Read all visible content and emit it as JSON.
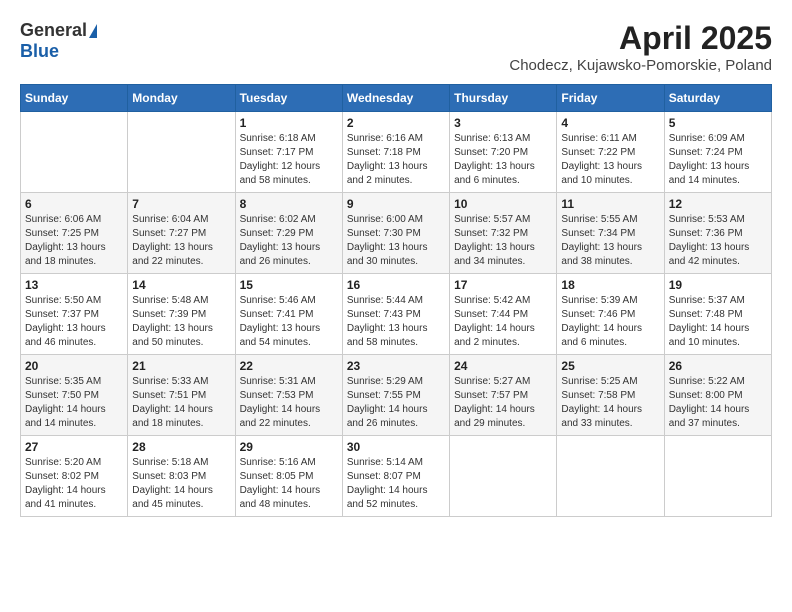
{
  "logo": {
    "general": "General",
    "blue": "Blue"
  },
  "title": {
    "month_year": "April 2025",
    "location": "Chodecz, Kujawsko-Pomorskie, Poland"
  },
  "weekdays": [
    "Sunday",
    "Monday",
    "Tuesday",
    "Wednesday",
    "Thursday",
    "Friday",
    "Saturday"
  ],
  "weeks": [
    [
      {
        "day": "",
        "detail": ""
      },
      {
        "day": "",
        "detail": ""
      },
      {
        "day": "1",
        "detail": "Sunrise: 6:18 AM\nSunset: 7:17 PM\nDaylight: 12 hours\nand 58 minutes."
      },
      {
        "day": "2",
        "detail": "Sunrise: 6:16 AM\nSunset: 7:18 PM\nDaylight: 13 hours\nand 2 minutes."
      },
      {
        "day": "3",
        "detail": "Sunrise: 6:13 AM\nSunset: 7:20 PM\nDaylight: 13 hours\nand 6 minutes."
      },
      {
        "day": "4",
        "detail": "Sunrise: 6:11 AM\nSunset: 7:22 PM\nDaylight: 13 hours\nand 10 minutes."
      },
      {
        "day": "5",
        "detail": "Sunrise: 6:09 AM\nSunset: 7:24 PM\nDaylight: 13 hours\nand 14 minutes."
      }
    ],
    [
      {
        "day": "6",
        "detail": "Sunrise: 6:06 AM\nSunset: 7:25 PM\nDaylight: 13 hours\nand 18 minutes."
      },
      {
        "day": "7",
        "detail": "Sunrise: 6:04 AM\nSunset: 7:27 PM\nDaylight: 13 hours\nand 22 minutes."
      },
      {
        "day": "8",
        "detail": "Sunrise: 6:02 AM\nSunset: 7:29 PM\nDaylight: 13 hours\nand 26 minutes."
      },
      {
        "day": "9",
        "detail": "Sunrise: 6:00 AM\nSunset: 7:30 PM\nDaylight: 13 hours\nand 30 minutes."
      },
      {
        "day": "10",
        "detail": "Sunrise: 5:57 AM\nSunset: 7:32 PM\nDaylight: 13 hours\nand 34 minutes."
      },
      {
        "day": "11",
        "detail": "Sunrise: 5:55 AM\nSunset: 7:34 PM\nDaylight: 13 hours\nand 38 minutes."
      },
      {
        "day": "12",
        "detail": "Sunrise: 5:53 AM\nSunset: 7:36 PM\nDaylight: 13 hours\nand 42 minutes."
      }
    ],
    [
      {
        "day": "13",
        "detail": "Sunrise: 5:50 AM\nSunset: 7:37 PM\nDaylight: 13 hours\nand 46 minutes."
      },
      {
        "day": "14",
        "detail": "Sunrise: 5:48 AM\nSunset: 7:39 PM\nDaylight: 13 hours\nand 50 minutes."
      },
      {
        "day": "15",
        "detail": "Sunrise: 5:46 AM\nSunset: 7:41 PM\nDaylight: 13 hours\nand 54 minutes."
      },
      {
        "day": "16",
        "detail": "Sunrise: 5:44 AM\nSunset: 7:43 PM\nDaylight: 13 hours\nand 58 minutes."
      },
      {
        "day": "17",
        "detail": "Sunrise: 5:42 AM\nSunset: 7:44 PM\nDaylight: 14 hours\nand 2 minutes."
      },
      {
        "day": "18",
        "detail": "Sunrise: 5:39 AM\nSunset: 7:46 PM\nDaylight: 14 hours\nand 6 minutes."
      },
      {
        "day": "19",
        "detail": "Sunrise: 5:37 AM\nSunset: 7:48 PM\nDaylight: 14 hours\nand 10 minutes."
      }
    ],
    [
      {
        "day": "20",
        "detail": "Sunrise: 5:35 AM\nSunset: 7:50 PM\nDaylight: 14 hours\nand 14 minutes."
      },
      {
        "day": "21",
        "detail": "Sunrise: 5:33 AM\nSunset: 7:51 PM\nDaylight: 14 hours\nand 18 minutes."
      },
      {
        "day": "22",
        "detail": "Sunrise: 5:31 AM\nSunset: 7:53 PM\nDaylight: 14 hours\nand 22 minutes."
      },
      {
        "day": "23",
        "detail": "Sunrise: 5:29 AM\nSunset: 7:55 PM\nDaylight: 14 hours\nand 26 minutes."
      },
      {
        "day": "24",
        "detail": "Sunrise: 5:27 AM\nSunset: 7:57 PM\nDaylight: 14 hours\nand 29 minutes."
      },
      {
        "day": "25",
        "detail": "Sunrise: 5:25 AM\nSunset: 7:58 PM\nDaylight: 14 hours\nand 33 minutes."
      },
      {
        "day": "26",
        "detail": "Sunrise: 5:22 AM\nSunset: 8:00 PM\nDaylight: 14 hours\nand 37 minutes."
      }
    ],
    [
      {
        "day": "27",
        "detail": "Sunrise: 5:20 AM\nSunset: 8:02 PM\nDaylight: 14 hours\nand 41 minutes."
      },
      {
        "day": "28",
        "detail": "Sunrise: 5:18 AM\nSunset: 8:03 PM\nDaylight: 14 hours\nand 45 minutes."
      },
      {
        "day": "29",
        "detail": "Sunrise: 5:16 AM\nSunset: 8:05 PM\nDaylight: 14 hours\nand 48 minutes."
      },
      {
        "day": "30",
        "detail": "Sunrise: 5:14 AM\nSunset: 8:07 PM\nDaylight: 14 hours\nand 52 minutes."
      },
      {
        "day": "",
        "detail": ""
      },
      {
        "day": "",
        "detail": ""
      },
      {
        "day": "",
        "detail": ""
      }
    ]
  ]
}
